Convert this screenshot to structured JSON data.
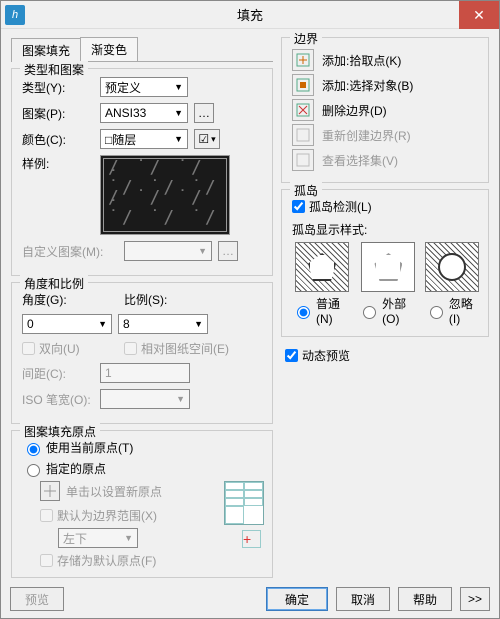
{
  "title": "填充",
  "tabs": {
    "hatch": "图案填充",
    "grad": "渐变色"
  },
  "g1": {
    "t": "类型和图案",
    "type_l": "类型(Y):",
    "type_v": "预定义",
    "pat_l": "图案(P):",
    "pat_v": "ANSI33",
    "col_l": "颜色(C):",
    "col_v": "□随层",
    "samp_l": "样例:",
    "cust_l": "自定义图案(M):"
  },
  "g2": {
    "t": "角度和比例",
    "ang_l": "角度(G):",
    "ang_v": "0",
    "sc_l": "比例(S):",
    "sc_v": "8",
    "dbl": "双向(U)",
    "rel": "相对图纸空间(E)",
    "sp_l": "间距(C):",
    "sp_v": "1",
    "iso_l": "ISO 笔宽(O):"
  },
  "g3": {
    "t": "图案填充原点",
    "cur": "使用当前原点(T)",
    "spec": "指定的原点",
    "click": "单击以设置新原点",
    "def": "默认为边界范围(X)",
    "pos": "左下",
    "store": "存储为默认原点(F)"
  },
  "g4": {
    "t": "边界",
    "b1": "添加:拾取点(K)",
    "b2": "添加:选择对象(B)",
    "b3": "删除边界(D)",
    "b4": "重新创建边界(R)",
    "b5": "查看选择集(V)"
  },
  "g5": {
    "t": "孤岛",
    "det": "孤岛检测(L)",
    "style": "孤岛显示样式:",
    "m1": "普通(N)",
    "m2": "外部(O)",
    "m3": "忽略(I)"
  },
  "dyn": "动态预览",
  "btns": {
    "prev": "预览",
    "ok": "确定",
    "cancel": "取消",
    "help": "帮助",
    "more": ">>"
  }
}
